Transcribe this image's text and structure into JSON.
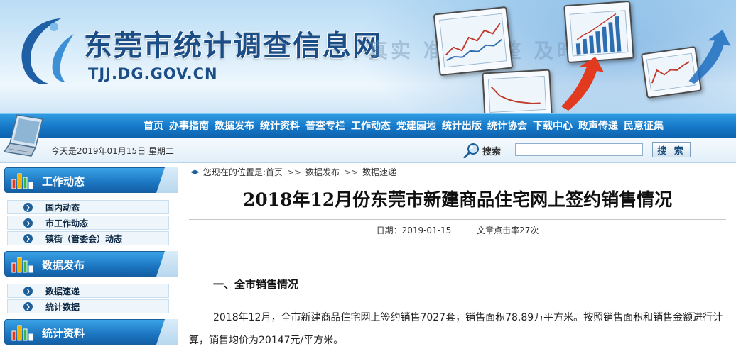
{
  "header": {
    "site_title": "东莞市统计调查信息网",
    "domain": "TJJ.DG.GOV.CN",
    "slogan": "真实 准确 完整 及时"
  },
  "nav": {
    "items": [
      "首页",
      "办事指南",
      "数据发布",
      "统计资料",
      "普查专栏",
      "工作动态",
      "党建园地",
      "统计出版",
      "统计协会",
      "下载中心",
      "政声传递",
      "民意征集"
    ]
  },
  "strip": {
    "today": "今天是2019年01月15日 星期二",
    "search_label": "搜索",
    "search_value": "",
    "search_button": "搜 索"
  },
  "sidebar": {
    "sections": [
      {
        "title": "工作动态",
        "items": [
          "国内动态",
          "市工作动态",
          "镇街（管委会）动态"
        ]
      },
      {
        "title": "数据发布",
        "items": [
          "数据速递",
          "统计数据"
        ]
      },
      {
        "title": "统计资料",
        "items": []
      }
    ]
  },
  "breadcrumb": {
    "prefix": "您现在的位置是:",
    "items": [
      "首页",
      "数据发布",
      "数据速递"
    ],
    "separator": ">>"
  },
  "article": {
    "title": "2018年12月份东莞市新建商品住宅网上签约销售情况",
    "date": "日期：2019-01-15",
    "hits": "文章点击率27次",
    "section_heading": "一、全市销售情况",
    "paragraph": "2018年12月，全市新建商品住宅网上签约销售7027套，销售面积78.89万平方米。按照销售面积和销售金额进行计算，销售均价为20147元/平方米。"
  },
  "colors": {
    "nav_blue": "#1678c8",
    "title_blue": "#1b4d86",
    "sidebar_head": "#1c76c1"
  },
  "icons": [
    "logo-swoosh-icon",
    "laptop-icon",
    "search-magnifier-icon",
    "bar-chart-icon",
    "bullet-arrow-icon",
    "breadcrumb-arrows-icon"
  ]
}
